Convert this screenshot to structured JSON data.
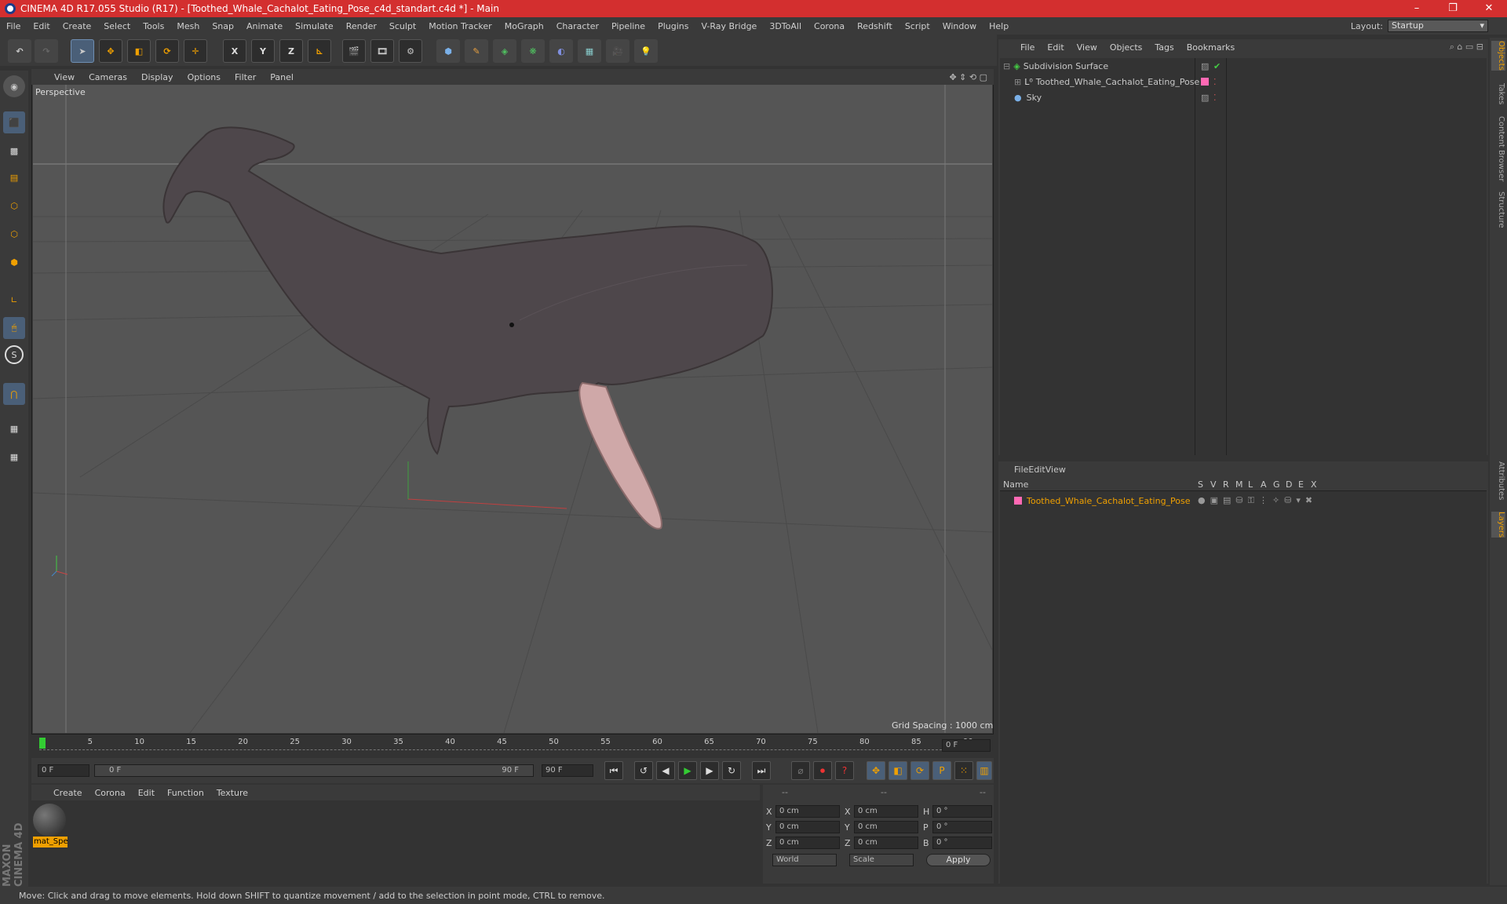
{
  "window": {
    "title": "CINEMA 4D R17.055 Studio (R17) - [Toothed_Whale_Cachalot_Eating_Pose_c4d_standart.c4d *] - Main",
    "controls": [
      "–",
      "❐",
      "✕"
    ]
  },
  "menubar": [
    "File",
    "Edit",
    "Create",
    "Select",
    "Tools",
    "Mesh",
    "Snap",
    "Animate",
    "Simulate",
    "Render",
    "Sculpt",
    "Motion Tracker",
    "MoGraph",
    "Character",
    "Pipeline",
    "Plugins",
    "V-Ray Bridge",
    "3DToAll",
    "Corona",
    "Redshift",
    "Script",
    "Window",
    "Help"
  ],
  "layout": {
    "label": "Layout:",
    "value": "Startup"
  },
  "toolbar": {
    "axis": [
      "X",
      "Y",
      "Z"
    ]
  },
  "viewport": {
    "menu": [
      "View",
      "Cameras",
      "Display",
      "Options",
      "Filter",
      "Panel"
    ],
    "label": "Perspective",
    "grid_spacing": "Grid Spacing : 1000 cm"
  },
  "timeline": {
    "ticks": [
      "0",
      "5",
      "10",
      "15",
      "20",
      "25",
      "30",
      "35",
      "40",
      "45",
      "50",
      "55",
      "60",
      "65",
      "70",
      "75",
      "80",
      "85",
      "90"
    ],
    "frame_end_field": "0 F"
  },
  "transport": {
    "start": "0 F",
    "range_start": "0 F",
    "range_end": "90 F",
    "end": "90 F"
  },
  "material_manager": {
    "menu": [
      "Create",
      "Corona",
      "Edit",
      "Function",
      "Texture"
    ],
    "material": "mat_Spe"
  },
  "coordinates": {
    "headers": [
      "--",
      "--",
      "--"
    ],
    "rows": [
      {
        "a": "X",
        "v1": "0 cm",
        "b": "X",
        "v2": "0 cm",
        "c": "H",
        "v3": "0 °"
      },
      {
        "a": "Y",
        "v1": "0 cm",
        "b": "Y",
        "v2": "0 cm",
        "c": "P",
        "v3": "0 °"
      },
      {
        "a": "Z",
        "v1": "0 cm",
        "b": "Z",
        "v2": "0 cm",
        "c": "B",
        "v3": "0 °"
      }
    ],
    "space": "World",
    "mode": "Scale",
    "apply": "Apply"
  },
  "object_manager": {
    "menu": [
      "File",
      "Edit",
      "View",
      "Objects",
      "Tags",
      "Bookmarks"
    ],
    "objects": [
      {
        "name": "Subdivision Surface"
      },
      {
        "name": "Toothed_Whale_Cachalot_Eating_Pose"
      },
      {
        "name": "Sky"
      }
    ]
  },
  "layer_manager": {
    "menu": [
      "File",
      "Edit",
      "View"
    ],
    "columns": [
      "Name",
      "S",
      "V",
      "R",
      "M",
      "L",
      "A",
      "G",
      "D",
      "E",
      "X"
    ],
    "layer": "Toothed_Whale_Cachalot_Eating_Pose"
  },
  "right_tabs": [
    "Objects",
    "Takes",
    "Content Browser",
    "Structure",
    "Attributes",
    "Layers"
  ],
  "brand": "MAXON CINEMA 4D",
  "status": "Move: Click and drag to move elements. Hold down SHIFT to quantize movement / add to the selection in point mode, CTRL to remove.",
  "colors": {
    "titlebar": "#d32f2f",
    "accent_orange": "#f0a000",
    "layer_pink": "#ff69b4"
  }
}
